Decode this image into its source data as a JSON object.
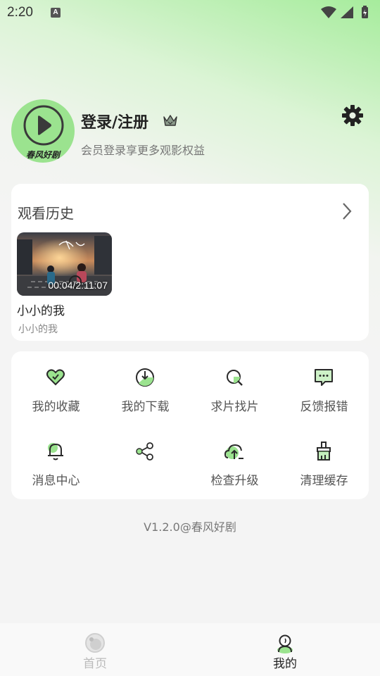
{
  "status_bar": {
    "time": "2:20",
    "notification_badge": "A"
  },
  "profile": {
    "login_title": "登录/注册",
    "subtitle": "会员登录享更多观影权益",
    "avatar_text": "春风好剧"
  },
  "history": {
    "title": "观看历史",
    "items": [
      {
        "title": "小小的我",
        "subtitle": "小小的我",
        "progress": "00:04/2:11:07"
      }
    ]
  },
  "menu": {
    "items": [
      {
        "label": "我的收藏",
        "icon": "heart-icon"
      },
      {
        "label": "我的下载",
        "icon": "download-icon"
      },
      {
        "label": "求片找片",
        "icon": "search-film-icon"
      },
      {
        "label": "反馈报错",
        "icon": "feedback-icon"
      },
      {
        "label": "消息中心",
        "icon": "bell-icon"
      },
      {
        "label": "",
        "icon": "share-icon"
      },
      {
        "label": "检查升级",
        "icon": "upgrade-icon"
      },
      {
        "label": "清理缓存",
        "icon": "clean-cache-icon"
      }
    ]
  },
  "version": "V1.2.0@春风好剧",
  "bottom_nav": {
    "items": [
      {
        "label": "首页",
        "icon": "home-icon",
        "active": false
      },
      {
        "label": "我的",
        "icon": "profile-icon",
        "active": true
      }
    ]
  },
  "colors": {
    "accent": "#8fe08a",
    "text_dark": "#222222",
    "text_muted": "#888888"
  }
}
